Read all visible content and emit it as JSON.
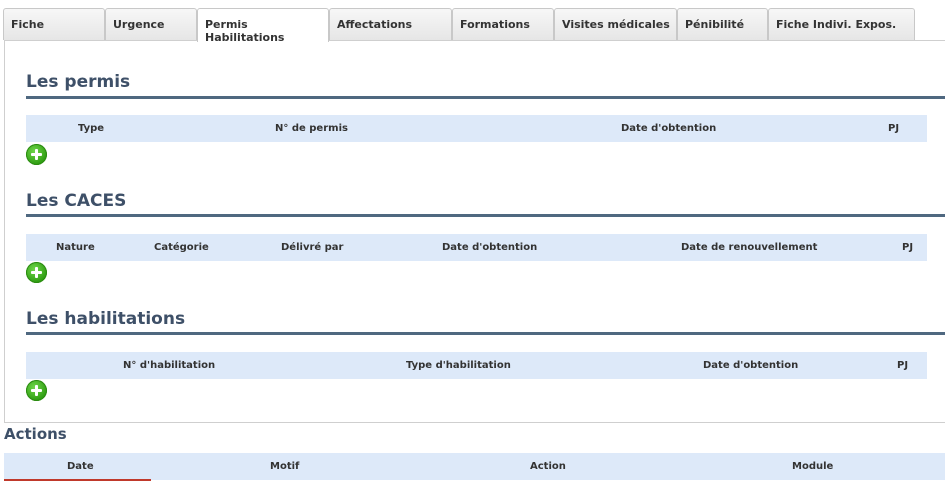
{
  "tabs": [
    {
      "label": "Fiche",
      "active": false
    },
    {
      "label": "Urgence",
      "active": false
    },
    {
      "label": "Permis Habilitations",
      "active": true
    },
    {
      "label": "Affectations",
      "active": false
    },
    {
      "label": "Formations",
      "active": false
    },
    {
      "label": "Visites médicales",
      "active": false
    },
    {
      "label": "Pénibilité",
      "active": false
    },
    {
      "label": "Fiche Indivi. Expos.",
      "active": false
    }
  ],
  "permis": {
    "title": "Les permis",
    "columns": [
      "Type",
      "N° de permis",
      "Date d'obtention",
      "PJ"
    ]
  },
  "caces": {
    "title": "Les CACES",
    "columns": [
      "Nature",
      "Catégorie",
      "Délivré par",
      "Date d'obtention",
      "Date de renouvellement",
      "PJ"
    ]
  },
  "habilitations": {
    "title": "Les habilitations",
    "columns": [
      "N° d'habilitation",
      "Type d'habilitation",
      "Date d'obtention",
      "PJ"
    ]
  },
  "actions": {
    "title": "Actions",
    "columns": [
      "Date",
      "Motif",
      "Action",
      "Module"
    ]
  },
  "colors": {
    "section_title": "#3e5068",
    "rule": "#4f6880",
    "table_header_bg": "#dde9f9",
    "add_button": "#3aa81a"
  },
  "icons": {
    "add": "plus-circle-icon"
  }
}
